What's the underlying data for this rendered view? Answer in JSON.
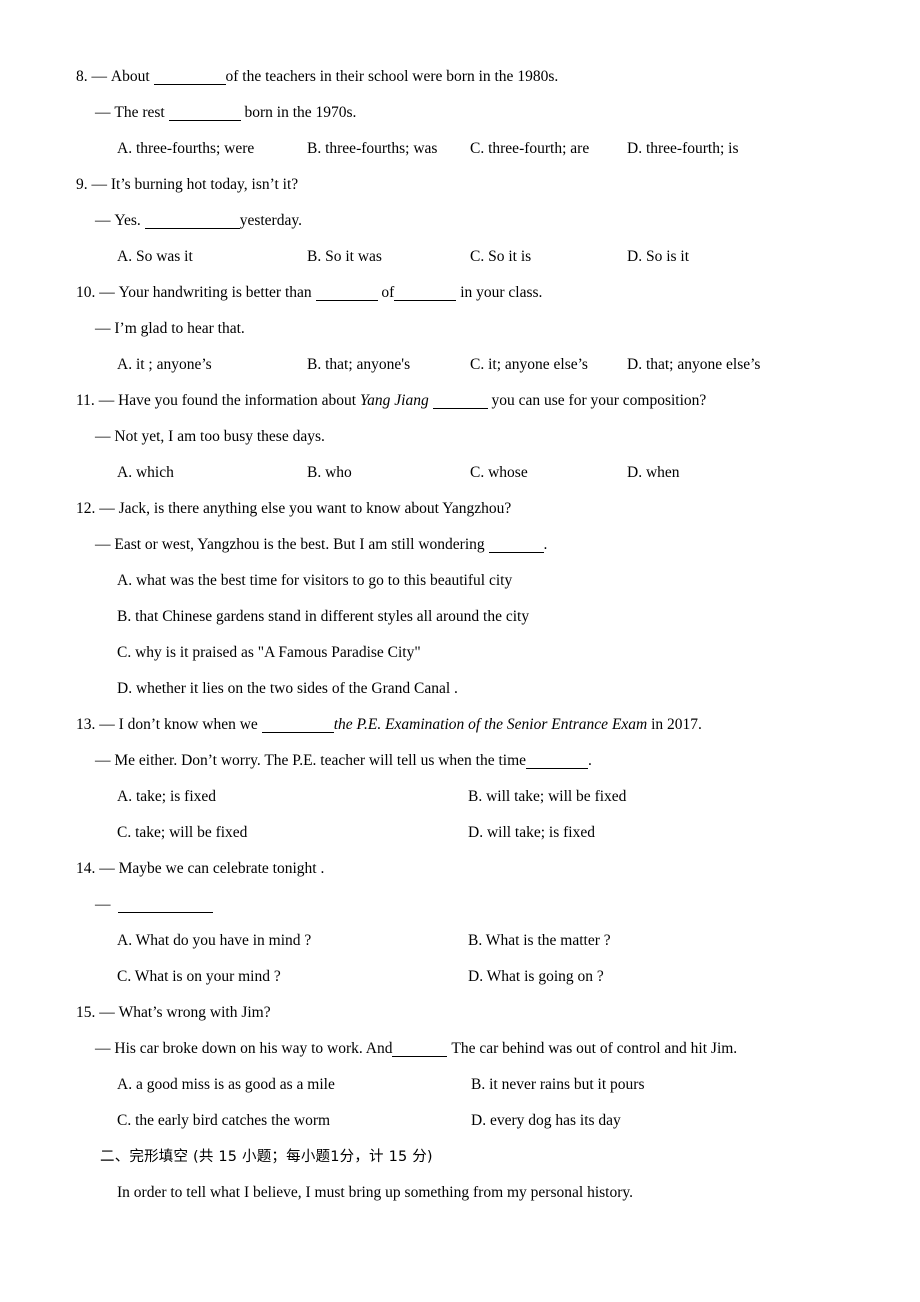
{
  "document": {
    "type": "exam-paper",
    "language": "English with Chinese section heading"
  },
  "questions": [
    {
      "number": "8.",
      "dash": "—",
      "stem_before": "About",
      "stem_after": "of the teachers in their school were born in the 1980s.",
      "reply_dash": "—",
      "reply_before": "The rest",
      "reply_after": "born in the 1970s.",
      "options_layout": "four-column",
      "options": [
        "A. three-fourths; were",
        "B. three-fourths; was",
        "C. three-fourth; are",
        "D. three-fourth; is"
      ]
    },
    {
      "number": "9.",
      "dash": "—",
      "stem": "It’s burning hot today, isn’t it?",
      "reply_dash": "—",
      "reply_before": "Yes.",
      "reply_after": "yesterday.",
      "options_layout": "four-column",
      "options": [
        "A. So was it",
        "B. So it was",
        "C. So it is",
        "D. So is it"
      ]
    },
    {
      "number": "10.",
      "dash": "—",
      "stem_before": "Your handwriting is better than",
      "stem_middle": "of",
      "stem_after": "in your class.",
      "reply_dash": "—",
      "reply": "I’m glad to hear that.",
      "options_layout": "four-column",
      "options": [
        "A. it ; anyone’s",
        "B. that; anyone's",
        "C. it; anyone else’s",
        "D. that; anyone else’s"
      ]
    },
    {
      "number": "11.",
      "dash": "—",
      "stem_before": "Have you found the information about",
      "stem_italic": "Yang Jiang",
      "stem_after": "you can use for your composition?",
      "reply_dash": "—",
      "reply": "Not yet, I am too busy these days.",
      "options_layout": "four-column",
      "options": [
        "A. which",
        "B. who",
        "C. whose",
        "D. when"
      ]
    },
    {
      "number": "12.",
      "dash": "—",
      "stem": "Jack, is there anything else you want to know about Yangzhou?",
      "reply_dash": "—",
      "reply_before": "East or west, Yangzhou is the best. But I am still wondering",
      "reply_after": ".",
      "options_layout": "stacked",
      "options": [
        "A. what was the best time for visitors to go to this beautiful city",
        "B. that Chinese gardens stand in different styles all around the city",
        "C. why is it praised as \"A Famous Paradise City\"",
        "D. whether it lies on the two sides of the Grand Canal ."
      ]
    },
    {
      "number": "13.",
      "dash": "—",
      "stem_before": "I don’t know when we",
      "stem_italic": "the P.E. Examination of the Senior Entrance Exam",
      "stem_after": "in 2017.",
      "reply_dash": "—",
      "reply_before": "Me either. Don’t worry. The P.E. teacher will tell us when the time",
      "reply_after": ".",
      "options_layout": "two-column",
      "options": [
        "A. take; is fixed",
        "B. will take; will be fixed",
        "C. take; will be fixed",
        "D. will take; is fixed"
      ]
    },
    {
      "number": "14.",
      "dash": "—",
      "stem": "Maybe we can celebrate tonight .",
      "reply_dash": "—",
      "reply_blank_only": true,
      "options_layout": "two-column",
      "options": [
        "A. What do you have in mind ?",
        "B. What is the matter ?",
        "C. What is on your mind ?",
        "D. What is going on ?"
      ]
    },
    {
      "number": "15.",
      "dash": "—",
      "stem": "What’s wrong with Jim?",
      "reply_dash": "—",
      "reply_before": "His car broke down on his way to work. And",
      "reply_after": "The car behind was out of control and hit Jim.",
      "options_layout": "two-column",
      "options": [
        "A. a good miss is as good as a mile",
        "B. it never rains but it pours",
        "C. the early bird catches the worm",
        "D. every dog has its day"
      ]
    }
  ],
  "section": {
    "heading": "二、完形填空 (共 15 小题；每小题1分，计 15 分)",
    "passage_first_line": "In order to tell what I believe, I must bring up something from my personal history."
  }
}
